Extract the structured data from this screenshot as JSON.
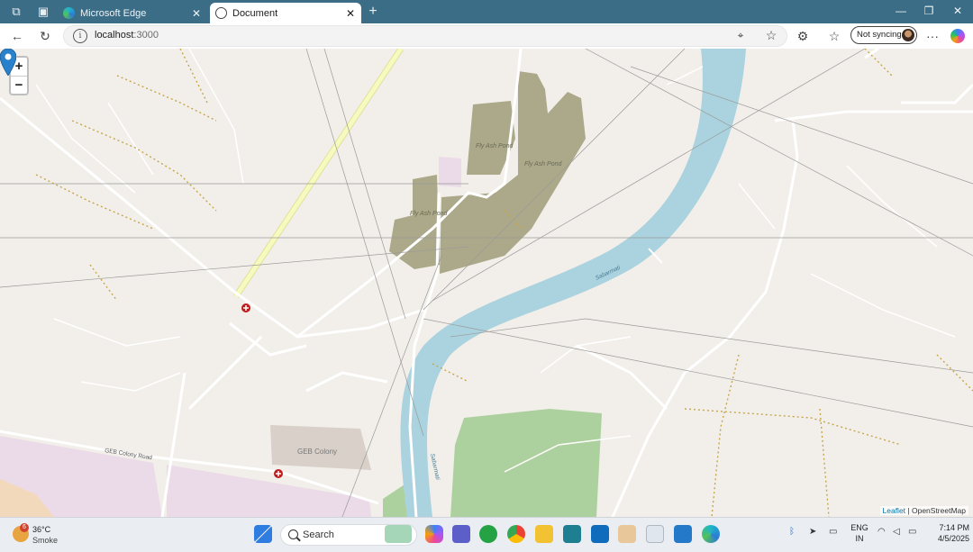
{
  "browser": {
    "tabs": [
      {
        "title": "Microsoft Edge",
        "active": false
      },
      {
        "title": "Document",
        "active": true
      }
    ],
    "address": {
      "host": "localhost",
      "port": ":3000"
    },
    "profile_button": "Not syncing",
    "accent_color": "#3b6d87"
  },
  "map": {
    "zoom_in": "+",
    "zoom_out": "−",
    "labels": {
      "pond_a": "Fly Ash Pond",
      "pond_b": "Fly Ash Pond",
      "pond_c": "Fly Ash Pond",
      "river_a": "Sabarmati",
      "river_b": "Sabarmati",
      "road": "GEB Colony Road",
      "colony": "GEB Colony"
    },
    "attribution": {
      "leaflet": "Leaflet",
      "separator": " | ",
      "osm": "OpenStreetMap"
    },
    "colors": {
      "water": "#aad3df",
      "landfill": "#aba98a",
      "forest": "#add19e",
      "highway": "#f7fabf",
      "marker": "#2a81cb"
    }
  },
  "taskbar": {
    "weather": {
      "temp": "36°C",
      "condition": "Smoke",
      "alert_count": "6"
    },
    "search_label": "Search",
    "language": [
      "ENG",
      "IN"
    ],
    "time": "7:14 PM",
    "date": "4/5/2025"
  }
}
